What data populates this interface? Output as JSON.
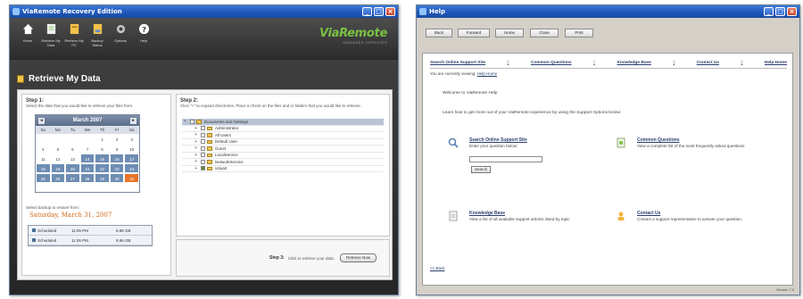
{
  "left_window": {
    "title": "ViaRemote Recovery Edition",
    "toolbar": [
      {
        "label": "Home",
        "icon": "home-icon"
      },
      {
        "label": "Retrieve My Data",
        "icon": "retrieve-icon"
      },
      {
        "label": "Retrieve My PC",
        "icon": "retrieve-pc-icon"
      },
      {
        "label": "Backup Status",
        "icon": "backup-status-icon"
      },
      {
        "label": "Options",
        "icon": "gear-icon"
      },
      {
        "label": "Help",
        "icon": "help-icon"
      }
    ],
    "brand": {
      "name": "ViaRemote",
      "tagline": "MANAGED SERVICES"
    },
    "page_title": "Retrieve My Data",
    "step1": {
      "heading": "Step 1:",
      "text": "Select the date that you would like to retrieve your files from.",
      "calendar": {
        "month": "March 2007",
        "prev": "◂",
        "next": "▸",
        "days_of_week": [
          "Su",
          "Mo",
          "Tu",
          "We",
          "Th",
          "Fr",
          "Sa"
        ],
        "weeks": [
          [
            "",
            "",
            "",
            "",
            "1",
            "2",
            "3"
          ],
          [
            "4",
            "5",
            "6",
            "7",
            "8",
            "9",
            "10"
          ],
          [
            "11",
            "12",
            "13",
            "14",
            "15",
            "16",
            "17"
          ],
          [
            "18",
            "19",
            "20",
            "21",
            "22",
            "23",
            "24"
          ],
          [
            "25",
            "26",
            "27",
            "28",
            "29",
            "30",
            "31"
          ]
        ],
        "backup_days": [
          "14",
          "15",
          "16",
          "17",
          "18",
          "19",
          "20",
          "21",
          "22",
          "23",
          "24",
          "25",
          "26",
          "27",
          "28",
          "29",
          "30"
        ],
        "selected_day": "31"
      },
      "select_label": "Select backup to restore from:",
      "selected_date": "Saturday, March 31, 2007",
      "schedule": [
        {
          "type": "Scheduled",
          "time": "11:05 PM",
          "size": "9.86 GB"
        },
        {
          "type": "Scheduled",
          "time": "11:05 PM",
          "size": "9.86 GB"
        }
      ]
    },
    "step2": {
      "heading": "Step 2:",
      "text": "Click \"+\" to expand directories. Place a check on the files and or folders that you would like to retrieve.",
      "tree": [
        {
          "label": "Documents and Settings",
          "checked": false,
          "root": true
        },
        {
          "label": "Administrator",
          "checked": false
        },
        {
          "label": "All Users",
          "checked": false
        },
        {
          "label": "Default User",
          "checked": false
        },
        {
          "label": "Guest",
          "checked": false
        },
        {
          "label": "LocalService",
          "checked": false
        },
        {
          "label": "NetworkService",
          "checked": false
        },
        {
          "label": "vstuart",
          "checked": true
        }
      ]
    },
    "step3": {
      "heading": "Step 3:",
      "text": "Click to retrieve your data.",
      "button": "Retrieve Now"
    }
  },
  "right_window": {
    "title": "Help",
    "toolbar_buttons": [
      "Back",
      "Forward",
      "Home",
      "Close",
      "Print"
    ],
    "nav": [
      "Search Online Support Site",
      "Common Questions",
      "Knowledge Base",
      "Contact Us",
      "Help Home"
    ],
    "nav_sep": "|",
    "viewing_label": "You are currently viewing:",
    "viewing_link": "Help Home",
    "welcome": "Welcome to ViaRemote Help",
    "intro": "Learn how to get more out of your ViaRemote experience by using the Support Options below:",
    "options": {
      "search": {
        "title": "Search Online Support Site",
        "text": "Enter your question below:",
        "button": "Search"
      },
      "common": {
        "title": "Common Questions",
        "text": "View a complete list of the most frequently asked questions"
      },
      "knowledge": {
        "title": "Knowledge Base",
        "text": "View a list of all available support articles listed by topic"
      },
      "contact": {
        "title": "Contact Us",
        "text": "Contact a support representative to answer your question."
      }
    },
    "back_link": "<< Back",
    "status": "Version 7.0"
  },
  "colors": {
    "brand_green": "#7ac143",
    "calendar_backup": "#6e8db3",
    "calendar_today": "#e8742b",
    "link": "#2a3f6e"
  }
}
